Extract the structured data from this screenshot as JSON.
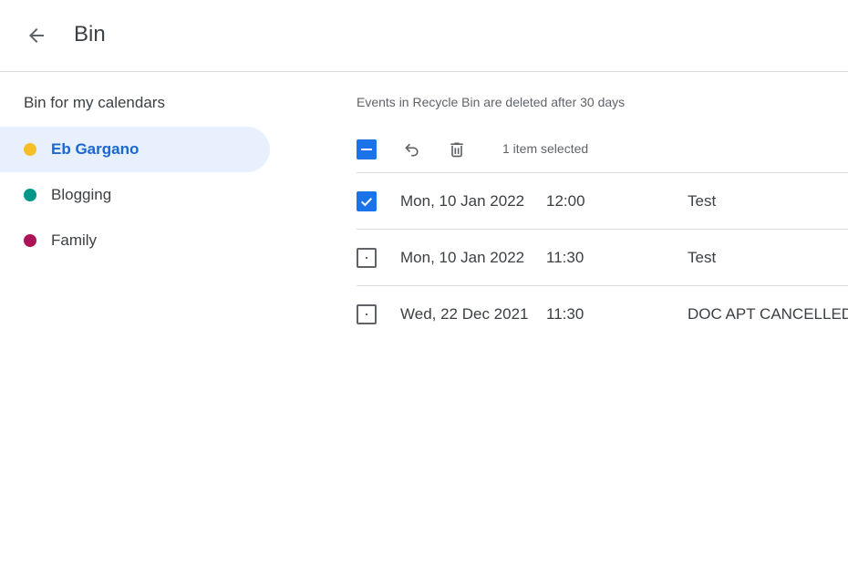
{
  "header": {
    "title": "Bin",
    "back_icon": "arrow-back-icon"
  },
  "sidebar": {
    "heading": "Bin for my calendars",
    "calendars": [
      {
        "label": "Eb Gargano",
        "color": "#f6bf26",
        "selected": true
      },
      {
        "label": "Blogging",
        "color": "#009688",
        "selected": false
      },
      {
        "label": "Family",
        "color": "#ad1457",
        "selected": false
      }
    ]
  },
  "main": {
    "info": "Events in Recycle Bin are deleted after 30 days",
    "toolbar": {
      "master_checkbox_state": "indeterminate",
      "restore_icon": "undo-icon",
      "delete_icon": "trash-icon",
      "selected_text": "1 item selected"
    },
    "events": [
      {
        "date": "Mon, 10 Jan 2022",
        "time": "12:00",
        "title": "Test",
        "checked": true
      },
      {
        "date": "Mon, 10 Jan 2022",
        "time": "11:30",
        "title": "Test",
        "checked": false
      },
      {
        "date": "Wed, 22 Dec 2021",
        "time": "11:30",
        "title": "DOC APT CANCELLED",
        "checked": false
      }
    ]
  },
  "colors": {
    "accent": "#1a73e8",
    "selected_bg": "#e8f0fe",
    "selected_text": "#1967d2",
    "divider": "#dadce0"
  }
}
